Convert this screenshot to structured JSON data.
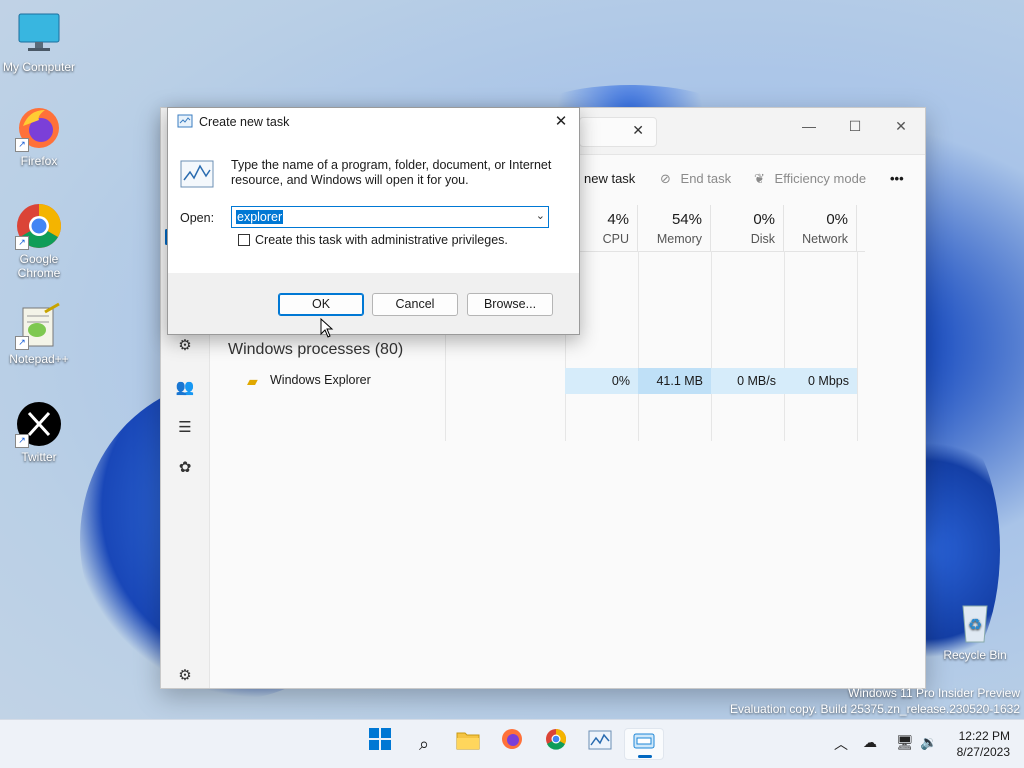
{
  "desktop": {
    "icons": [
      {
        "label": "My Computer"
      },
      {
        "label": "Firefox"
      },
      {
        "label": "Google Chrome"
      },
      {
        "label": "Notepad++"
      },
      {
        "label": "Twitter"
      },
      {
        "label": "Recycle Bin"
      }
    ]
  },
  "task_manager": {
    "toolbar": {
      "new_task": "new task",
      "end_task": "End task",
      "efficiency_mode": "Efficiency mode",
      "more": "•••"
    },
    "columns": [
      {
        "pct": "4%",
        "label": "CPU"
      },
      {
        "pct": "54%",
        "label": "Memory"
      },
      {
        "pct": "0%",
        "label": "Disk"
      },
      {
        "pct": "0%",
        "label": "Network"
      }
    ],
    "group_title": "Windows processes (80)",
    "process": {
      "name": "Windows Explorer",
      "cpu": "0%",
      "memory": "41.1 MB",
      "disk": "0 MB/s",
      "network": "0 Mbps"
    }
  },
  "run_dialog": {
    "title": "Create new task",
    "description": "Type the name of a program, folder, document, or Internet resource, and Windows will open it for you.",
    "open_label": "Open:",
    "open_value": "explorer",
    "admin_checkbox_label": "Create this task with administrative privileges.",
    "admin_checked": false,
    "ok_label": "OK",
    "cancel_label": "Cancel",
    "browse_label": "Browse..."
  },
  "watermark": {
    "line1": "Windows 11 Pro Insider Preview",
    "line2": "Evaluation copy. Build 25375.zn_release.230520-1632"
  },
  "taskbar": {
    "time": "12:22 PM",
    "date": "8/27/2023",
    "colors": {
      "accent": "#0067c0",
      "selection": "#0078d4",
      "memory_highlight": "#bfe0f7"
    }
  }
}
